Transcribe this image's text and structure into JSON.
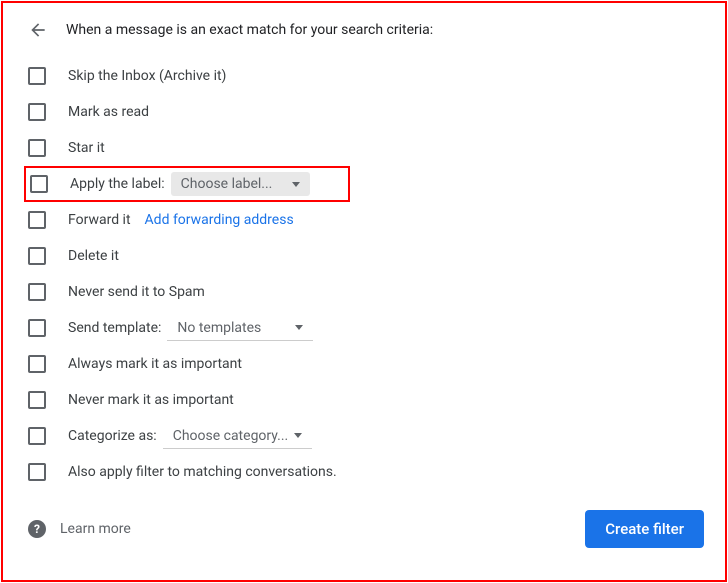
{
  "header": {
    "title": "When a message is an exact match for your search criteria:"
  },
  "options": {
    "skip_inbox": "Skip the Inbox (Archive it)",
    "mark_read": "Mark as read",
    "star_it": "Star it",
    "apply_label": "Apply the label:",
    "apply_label_dropdown": "Choose label...",
    "forward_it": "Forward it",
    "forward_link": "Add forwarding address",
    "delete_it": "Delete it",
    "never_spam": "Never send it to Spam",
    "send_template": "Send template:",
    "send_template_dropdown": "No templates",
    "always_important": "Always mark it as important",
    "never_important": "Never mark it as important",
    "categorize_as": "Categorize as:",
    "categorize_dropdown": "Choose category...",
    "also_apply": "Also apply filter to matching conversations."
  },
  "footer": {
    "help_glyph": "?",
    "learn_more": "Learn more",
    "create_filter": "Create filter"
  }
}
